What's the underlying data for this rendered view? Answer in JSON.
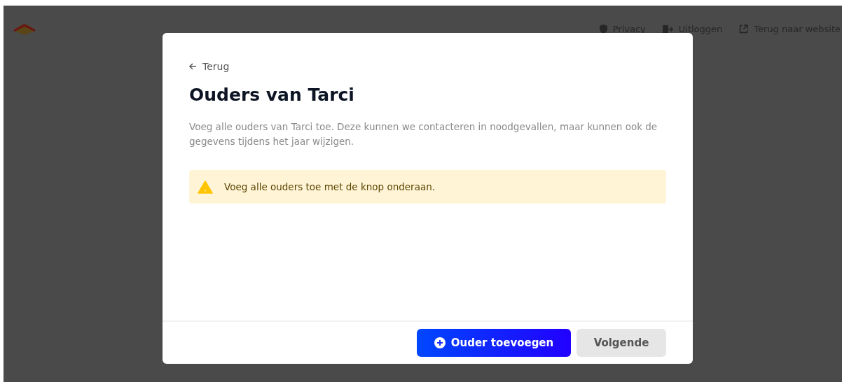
{
  "header": {
    "links": [
      {
        "kind": "privacy",
        "label": "Privacy"
      },
      {
        "kind": "logout",
        "label": "Uitloggen"
      },
      {
        "kind": "external",
        "label": "Terug naar website"
      }
    ]
  },
  "modal": {
    "back_link": "Terug",
    "title": "Ouders van Tarci",
    "description": "Voeg alle ouders van Tarci toe. Deze kunnen we contacteren in noodgevallen, maar kunnen ook de gegevens tijdens het jaar wijzigen.",
    "alert": {
      "kind": "warning",
      "text": "Voeg alle ouders toe met de knop onderaan."
    },
    "buttons": [
      {
        "kind": "primary",
        "label": "Ouder toevoegen"
      },
      {
        "kind": "secondary",
        "label": "Volgende"
      }
    ]
  }
}
